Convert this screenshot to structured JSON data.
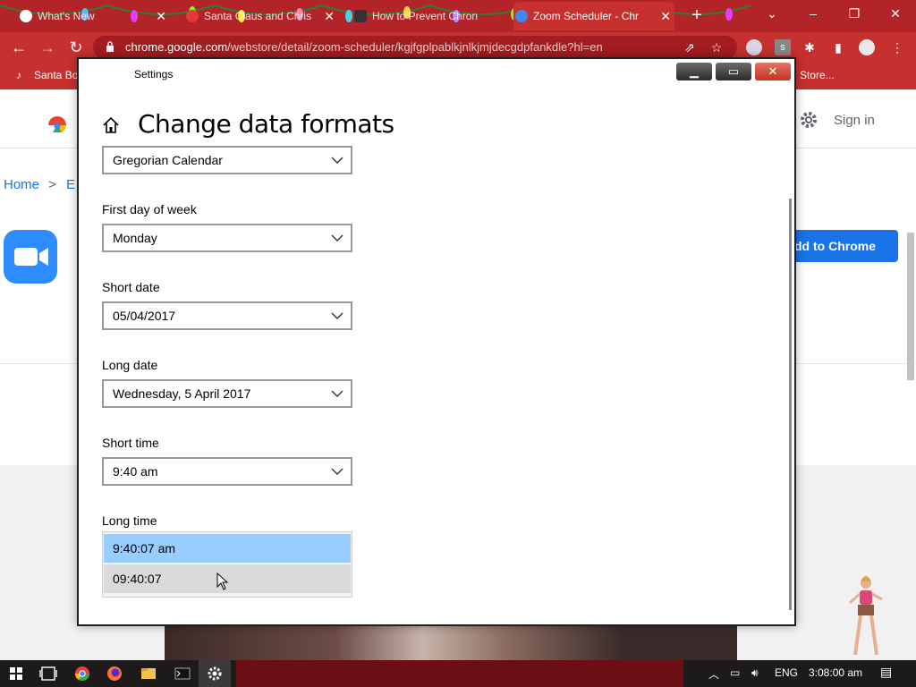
{
  "browser": {
    "tabs": [
      {
        "label": "What's New",
        "active": false
      },
      {
        "label": "Santa Claus and Chris",
        "active": false
      },
      {
        "label": "How to Prevent Chron",
        "active": false
      },
      {
        "label": "Zoom Scheduler - Chr",
        "active": true
      }
    ],
    "url_host": "chrome.google.com",
    "url_path": "/webstore/detail/zoom-scheduler/kgjfgplpablkjnlkjmjdecgdpfankdle?hl=en",
    "bookmarks": [
      {
        "label": "Santa Bo"
      },
      {
        "label": "Store..."
      }
    ],
    "accent": "#c6302f"
  },
  "store_page": {
    "sign_in": "Sign in",
    "breadcrumb_home": "Home",
    "breadcrumb_sep": ">",
    "breadcrumb_next": "E",
    "add_button": "dd to Chrome"
  },
  "settings": {
    "window_title": "Settings",
    "heading": "Change data formats",
    "calendar_value": "Gregorian Calendar",
    "fields": [
      {
        "label": "First day of week",
        "value": "Monday"
      },
      {
        "label": "Short date",
        "value": "05/04/2017"
      },
      {
        "label": "Long date",
        "value": "Wednesday, 5 April 2017"
      },
      {
        "label": "Short time",
        "value": "9:40 am"
      }
    ],
    "long_time": {
      "label": "Long time",
      "options": [
        "9:40:07 am",
        "09:40:07"
      ],
      "selected": "9:40:07 am"
    }
  },
  "taskbar": {
    "language": "ENG",
    "clock": "3:08:00 am"
  }
}
